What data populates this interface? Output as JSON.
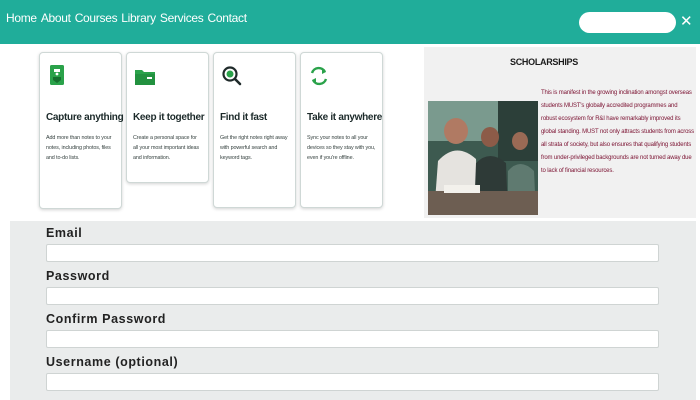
{
  "nav": {
    "links": [
      "Home",
      "About",
      "Courses",
      "Library",
      "Services",
      "Contact"
    ],
    "search_placeholder": "",
    "close_glyph": "✕",
    "color": "#20ad9a"
  },
  "cards": [
    {
      "title": "Capture anything",
      "desc": "Add more than notes to your notes, including photos, files and to-do lists.",
      "icon": "sticky-note-icon"
    },
    {
      "title": "Keep it together",
      "desc": "Create a personal space for all your most important ideas and information.",
      "icon": "folder-icon"
    },
    {
      "title": "Find it fast",
      "desc": "Get the right notes right away with powerful search and keyword tags.",
      "icon": "search-icon"
    },
    {
      "title": "Take it anywhere",
      "desc": "Sync your notes to all your devices so they stay with you, even if you're offline.",
      "icon": "sync-icon"
    }
  ],
  "scholarships": {
    "title": "SCHOLARSHIPS",
    "text": "This is manifest in the growing inclination amongst overseas students MUST's globally accredited programmes and robust ecosystem for R&I have remarkably improved its global standing. MUST not only attracts students from across all strata of society, but also ensures that qualifying students from under-privileged backgrounds are not turned away due to lack of financial resources.",
    "image": "students-photo"
  },
  "form": {
    "fields": [
      {
        "label": "Email",
        "value": ""
      },
      {
        "label": "Password",
        "value": ""
      },
      {
        "label": "Confirm Password",
        "value": ""
      },
      {
        "label": "Username (optional)",
        "value": ""
      }
    ]
  }
}
